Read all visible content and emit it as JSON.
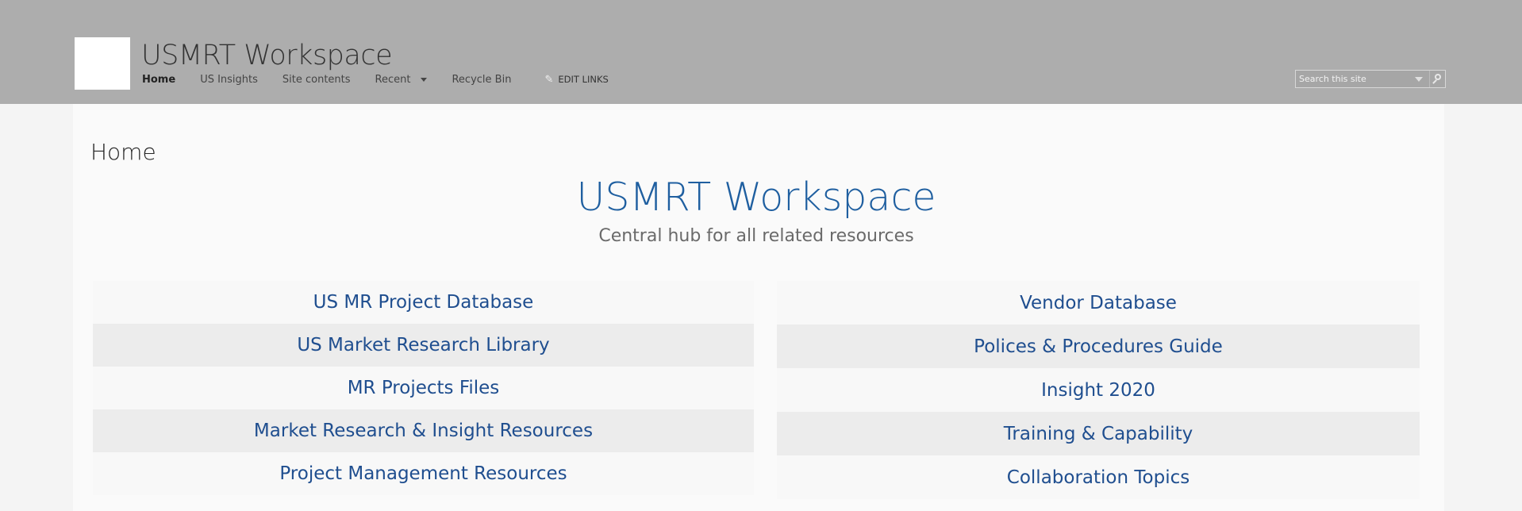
{
  "header": {
    "site_title": "USMRT Workspace",
    "nav": [
      {
        "label": "Home",
        "active": true
      },
      {
        "label": "US Insights"
      },
      {
        "label": "Site contents"
      },
      {
        "label": "Recent",
        "has_dropdown": true
      },
      {
        "label": "Recycle Bin"
      }
    ],
    "edit_links": {
      "label": "EDIT LINKS",
      "icon": "pencil-icon"
    },
    "search": {
      "placeholder": "Search this site",
      "scope_icon": "chevron-down-icon",
      "go_icon": "search-icon"
    }
  },
  "main": {
    "page_title": "Home",
    "hero_title": "USMRT Workspace",
    "hero_subtitle": "Central hub for all related resources",
    "left_links": [
      "US MR Project Database",
      "US Market Research Library",
      "MR Projects Files",
      "Market Research & Insight Resources",
      "Project Management Resources"
    ],
    "right_links": [
      "Vendor Database",
      "Polices & Procedures Guide",
      "Insight 2020",
      "Training & Capability",
      "Collaboration Topics"
    ]
  },
  "colors": {
    "suite_bar": "#adadad",
    "link": "#1f4e8f",
    "hero_title": "#1f5fa0",
    "row_alt": "#ececec"
  }
}
